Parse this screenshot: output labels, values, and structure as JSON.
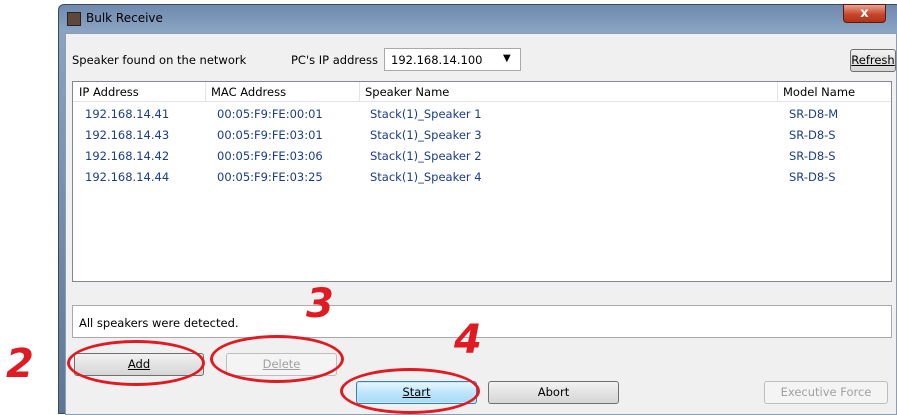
{
  "window": {
    "title": "Bulk Receive",
    "close_glyph": "x"
  },
  "header": {
    "found_label": "Speaker found on the network",
    "ip_label": "PC's IP address",
    "ip_value": "192.168.14.100",
    "refresh_label": "Refresh"
  },
  "table": {
    "columns": [
      "IP Address",
      "MAC Address",
      "Speaker Name",
      "Model Name"
    ],
    "rows": [
      [
        "192.168.14.41",
        "00:05:F9:FE:00:01",
        "Stack(1)_Speaker 1",
        "SR-D8-M"
      ],
      [
        "192.168.14.43",
        "00:05:F9:FE:03:01",
        "Stack(1)_Speaker 3",
        "SR-D8-S"
      ],
      [
        "192.168.14.42",
        "00:05:F9:FE:03:06",
        "Stack(1)_Speaker 2",
        "SR-D8-S"
      ],
      [
        "192.168.14.44",
        "00:05:F9:FE:03:25",
        "Stack(1)_Speaker 4",
        "SR-D8-S"
      ]
    ]
  },
  "status": {
    "message": "All speakers were detected."
  },
  "buttons": {
    "add": "Add",
    "delete": "Delete",
    "start": "Start",
    "abort": "Abort",
    "executive_force": "Executive Force"
  },
  "annotations": {
    "step_add": "2",
    "step_delete": "3",
    "step_start": "4"
  },
  "colors": {
    "accent_red": "#e01a22",
    "row_text": "#1a3d8a"
  }
}
